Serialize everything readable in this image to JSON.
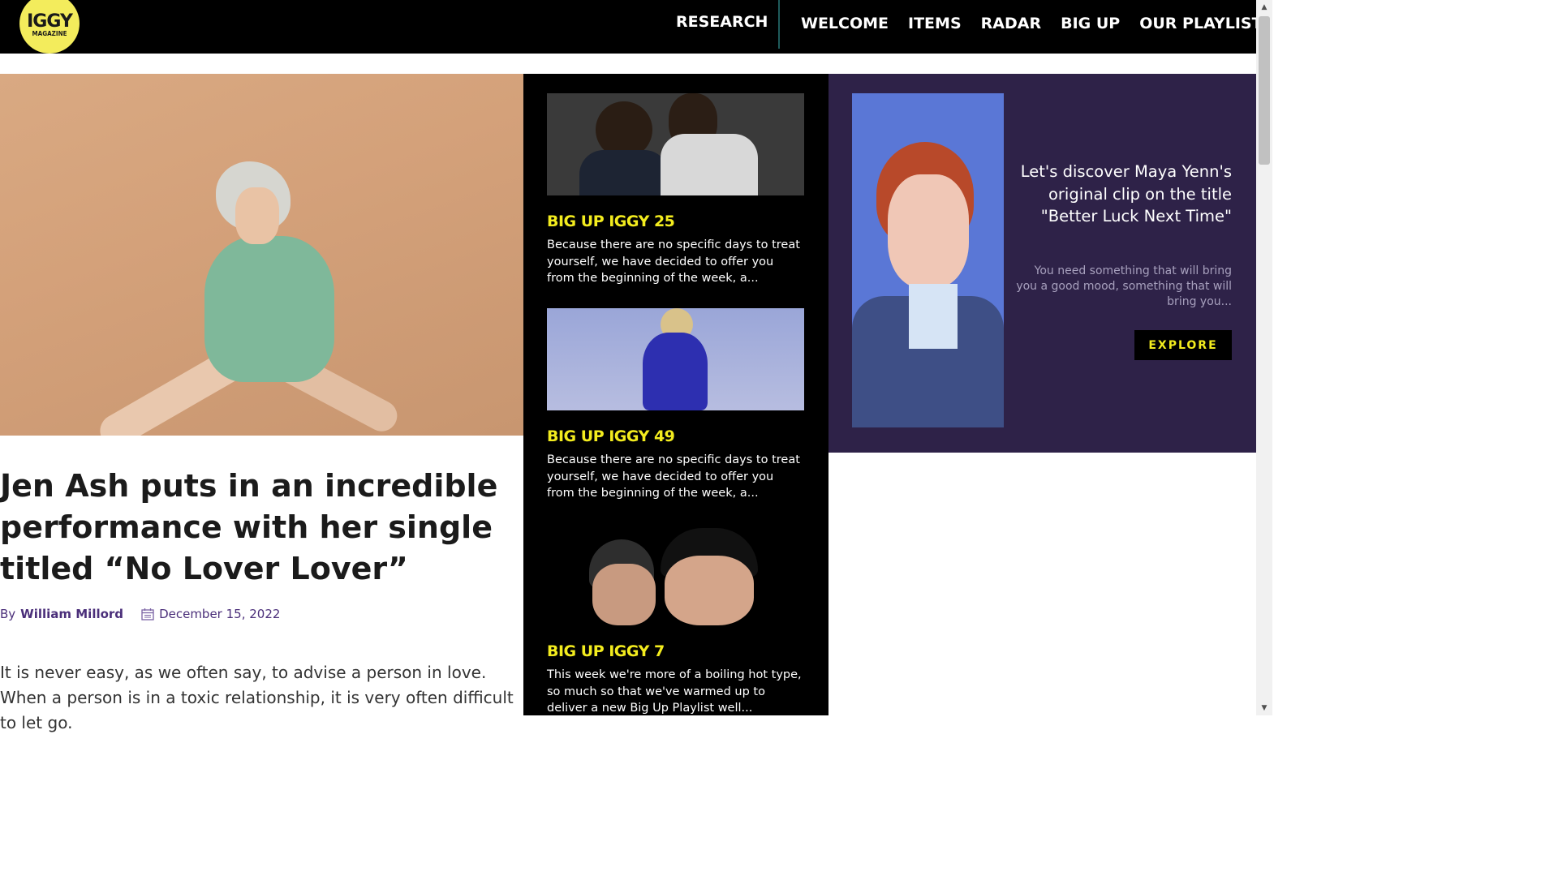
{
  "logo": {
    "main": "IGGY",
    "sub": "MAGAZINE"
  },
  "nav": {
    "research": "RESEARCH",
    "links": [
      "WELCOME",
      "ITEMS",
      "RADAR",
      "BIG UP",
      "OUR PLAYLISTS"
    ]
  },
  "article": {
    "title": "Jen Ash puts in an incredible performance with her single titled “No Lover Lover”",
    "by": "By",
    "author": "William Millord",
    "date": "December 15, 2022",
    "excerpt": "It is never easy, as we often say, to advise a person in love. When a person is in a toxic relationship, it is very often difficult to let go."
  },
  "cards": [
    {
      "title": "BIG UP IGGY 25",
      "text": "Because there are no specific days to treat yourself, we have decided to offer you from the beginning of the week, a..."
    },
    {
      "title": "BIG UP IGGY 49",
      "text": "Because there are no specific days to treat yourself, we have decided to offer you from the beginning of the week, a..."
    },
    {
      "title": "BIG UP IGGY 7",
      "text": "This week we're more of a boiling hot type, so much so that we've warmed up to deliver a new Big Up Playlist well..."
    }
  ],
  "promo": {
    "heading": "Let's discover Maya Yenn's original clip on the title \"Better Luck Next Time\"",
    "text": "You need something that will bring you a good mood, something that will bring you...",
    "button": "EXPLORE"
  },
  "colors": {
    "accent_yellow": "#f3ec1e",
    "promo_bg": "#2e2248",
    "author_purple": "#4b2f7a"
  }
}
